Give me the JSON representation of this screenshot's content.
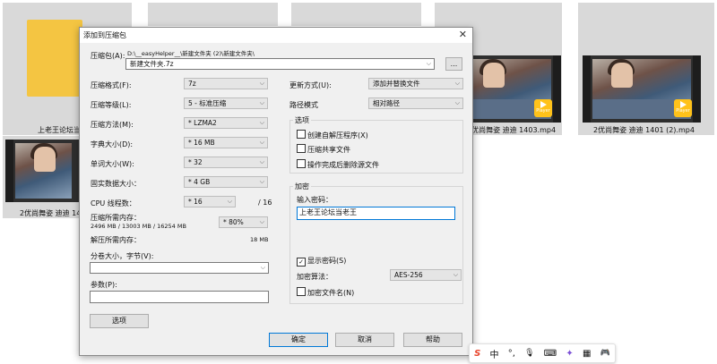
{
  "background_files": {
    "folder_label": "上老王论坛当",
    "video_left_label": "2优尚舞姿 迪迪 140",
    "video_mid_label": "2优尚舞姿 迪迪 1403.mp4",
    "video_right_label": "2优尚舞姿 迪迪 1401 (2).mp4",
    "play_badge": "Player"
  },
  "dialog": {
    "title": "添加到压缩包",
    "archive_label": "压缩包(A):",
    "archive_path": "D:\\__easyHelper__\\新建文件夹 (2)\\新建文件夹\\",
    "archive_name": "新建文件夹.7z",
    "browse_label": "...",
    "format_label": "压缩格式(F):",
    "format_value": "7z",
    "level_label": "压缩等级(L):",
    "level_value": "5 - 标准压缩",
    "method_label": "压缩方法(M):",
    "method_value": "* LZMA2",
    "dict_label": "字典大小(D):",
    "dict_value": "* 16 MB",
    "word_label": "单词大小(W):",
    "word_value": "* 32",
    "solid_label": "固实数据大小：",
    "solid_value": "* 4 GB",
    "cpu_label": "CPU 线程数：",
    "cpu_value": "* 16",
    "cpu_total": "/ 16",
    "mem_compress_label": "压缩所需内存：",
    "mem_compress_value": "2496 MB / 13003 MB / 16254 MB",
    "mem_percent": "* 80%",
    "mem_decompress_label": "解压所需内存：",
    "mem_decompress_value": "18 MB",
    "split_label": "分卷大小，字节(V):",
    "split_value": "",
    "params_label": "参数(P):",
    "params_value": "",
    "options_button": "选项",
    "update_label": "更新方式(U):",
    "update_value": "添加并替换文件",
    "path_label": "路径模式",
    "path_value": "相对路径",
    "options_group": "选项",
    "opt_sfx": "创建自解压程序(X)",
    "opt_shared": "压缩共享文件",
    "opt_delete": "操作完成后删除源文件",
    "encrypt_group": "加密",
    "password_label": "输入密码：",
    "password_value": "上老王论坛当老王",
    "show_password": "显示密码(S)",
    "show_password_checked": true,
    "enc_method_label": "加密算法：",
    "enc_method_value": "AES-256",
    "encrypt_names": "加密文件名(N)",
    "ok_button": "确定",
    "cancel_button": "取消",
    "help_button": "帮助"
  },
  "ime_toolbar": {
    "logo": "S",
    "mode": "中",
    "punct": "°,",
    "mic": "🎙",
    "keyboard": "⌨",
    "skin": "✦",
    "grid": "▦",
    "extra": "🎮"
  }
}
